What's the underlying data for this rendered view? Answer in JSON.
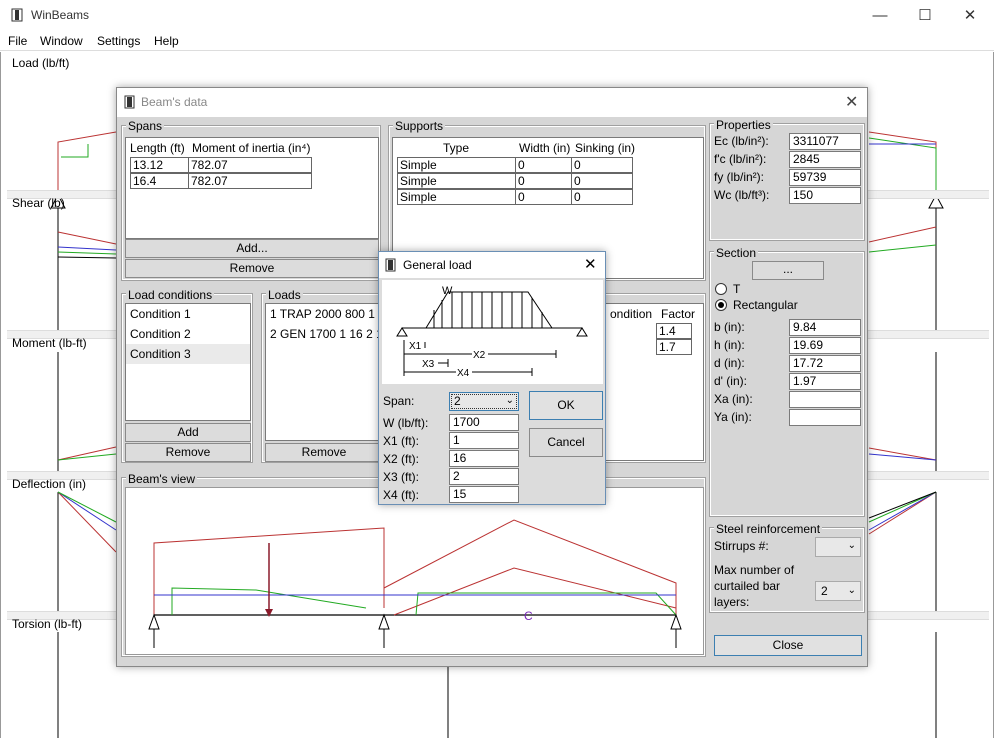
{
  "app": {
    "title": "WinBeams",
    "controls": [
      "—",
      "☐",
      "✕"
    ],
    "mdi_controls": [
      "_",
      "⧉",
      "✕"
    ]
  },
  "menu": [
    "File",
    "Window",
    "Settings",
    "Help"
  ],
  "plots": [
    "Load (lb/ft)",
    "Shear (lb)",
    "Moment (lb-ft)",
    "Deflection (in)",
    "Torsion (lb-ft)"
  ],
  "beams_dialog": {
    "title": "Beam's data",
    "spans": {
      "title": "Spans",
      "headers": [
        "Length (ft)",
        "Moment of inertia (in⁴)"
      ],
      "rows": [
        [
          "13.12",
          "782.07"
        ],
        [
          "16.4",
          "782.07"
        ]
      ],
      "add_label": "Add...",
      "remove_label": "Remove"
    },
    "supports": {
      "title": "Supports",
      "headers": [
        "Type",
        "Width (in)",
        "Sinking (in)"
      ],
      "rows": [
        [
          "Simple",
          "0",
          "0"
        ],
        [
          "Simple",
          "0",
          "0"
        ],
        [
          "Simple",
          "0",
          "0"
        ]
      ]
    },
    "properties": {
      "title": "Properties",
      "fields": [
        {
          "label": "Ec (lb/in²):",
          "value": "3311077"
        },
        {
          "label": "f'c (lb/in²):",
          "value": "2845"
        },
        {
          "label": "fy (lb/in²):",
          "value": "59739"
        },
        {
          "label": "Wc (lb/ft³):",
          "value": "150"
        }
      ]
    },
    "section": {
      "title": "Section",
      "button_label": "...",
      "options": [
        "T",
        "Rectangular"
      ],
      "selected": "Rectangular",
      "fields": [
        {
          "label": "b (in):",
          "value": "9.84"
        },
        {
          "label": "h (in):",
          "value": "19.69"
        },
        {
          "label": "d (in):",
          "value": "17.72"
        },
        {
          "label": "d' (in):",
          "value": "1.97"
        },
        {
          "label": "Xa (in):",
          "value": ""
        },
        {
          "label": "Ya (in):",
          "value": ""
        }
      ]
    },
    "load_conditions": {
      "title": "Load conditions",
      "items": [
        "Condition 1",
        "Condition 2",
        "Condition 3"
      ],
      "selected": "Condition 3",
      "add_label": "Add",
      "remove_label": "Remove"
    },
    "loads": {
      "title": "Loads",
      "items": [
        "1 TRAP 2000 800 1 1",
        "2 GEN 1700 1 16 2 1"
      ],
      "remove_label": "Remove"
    },
    "combination": {
      "headers": [
        "ondition",
        "Factor"
      ],
      "rows": [
        [
          "",
          "1.4"
        ],
        [
          "",
          "1.7"
        ]
      ]
    },
    "steel": {
      "title": "Steel reinforcement",
      "stirrups_label": "Stirrups #:",
      "stirrups_value": "",
      "max_layers_label": "Max number of curtailed bar layers:",
      "max_layers_value": "2"
    },
    "view_title": "Beam's view",
    "close_label": "Close"
  },
  "general_load": {
    "title": "General load",
    "diagram_labels": [
      "W",
      "X1",
      "X2",
      "X3",
      "X4"
    ],
    "fields": [
      {
        "label": "Span:",
        "value": "2"
      },
      {
        "label": "W (lb/ft):",
        "value": "1700"
      },
      {
        "label": "X1 (ft):",
        "value": "1"
      },
      {
        "label": "X2 (ft):",
        "value": "16"
      },
      {
        "label": "X3 (ft):",
        "value": "2"
      },
      {
        "label": "X4 (ft):",
        "value": "15"
      }
    ],
    "ok_label": "OK",
    "cancel_label": "Cancel"
  }
}
